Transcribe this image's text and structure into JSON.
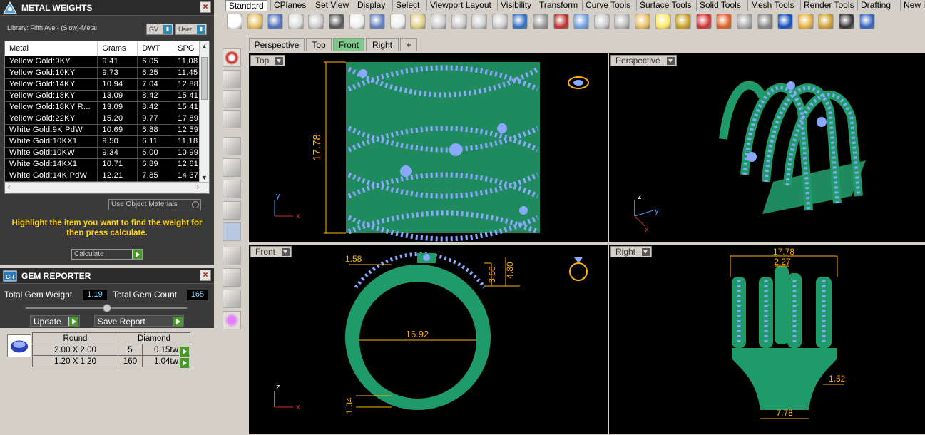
{
  "metal_panel": {
    "title": "METAL WEIGHTS",
    "library": "Library: Fifth Ave - (Slow)-Metal",
    "gv_label": "GV",
    "user_label": "User",
    "columns": [
      "Metal",
      "Grams",
      "DWT",
      "SPG"
    ],
    "rows": [
      [
        "Yellow Gold:9KY",
        "9.41",
        "6.05",
        "11.08"
      ],
      [
        "Yellow Gold:10KY",
        "9.73",
        "6.25",
        "11.45"
      ],
      [
        "Yellow Gold:14KY",
        "10.94",
        "7.04",
        "12.88"
      ],
      [
        "Yellow Gold:18KY",
        "13.09",
        "8.42",
        "15.41"
      ],
      [
        "Yellow Gold:18KY R...",
        "13.09",
        "8.42",
        "15.41"
      ],
      [
        "Yellow Gold:22KY",
        "15.20",
        "9.77",
        "17.89"
      ],
      [
        "White Gold:9K PdW",
        "10.69",
        "6.88",
        "12.59"
      ],
      [
        "White Gold:10KX1",
        "9.50",
        "6.11",
        "11.18"
      ],
      [
        "White Gold:10KW",
        "9.34",
        "6.00",
        "10.99"
      ],
      [
        "White Gold:14KX1",
        "10.71",
        "6.89",
        "12.61"
      ],
      [
        "White Gold:14K PdW",
        "12.21",
        "7.85",
        "14.37"
      ]
    ],
    "use_object_materials": "Use Object Materials",
    "hint": "Highlight the item you want to find the weight for then press calculate.",
    "calculate_label": "Calculate"
  },
  "gem_panel": {
    "title": "GEM REPORTER",
    "total_weight_label": "Total Gem Weight",
    "total_weight": "1.19",
    "total_count_label": "Total Gem Count",
    "total_count": "165",
    "update_label": "Update",
    "save_label": "Save Report",
    "shape": "Round",
    "stone": "Diamond",
    "rows": [
      {
        "size": "2.00 X 2.00",
        "count": "5",
        "tw": "0.15tw"
      },
      {
        "size": "1.20 X 1.20",
        "count": "160",
        "tw": "1.04tw"
      }
    ]
  },
  "menu_tabs": [
    "Standard",
    "CPlanes",
    "Set View",
    "Display",
    "Select",
    "Viewport Layout",
    "Visibility",
    "Transform",
    "Curve Tools",
    "Surface Tools",
    "Solid Tools",
    "Mesh Tools",
    "Render Tools",
    "Drafting",
    "New in"
  ],
  "view_tabs": [
    "Perspective",
    "Top",
    "Front",
    "Right",
    "+"
  ],
  "viewports": {
    "top": {
      "label": "Top",
      "dim_height": "17.78"
    },
    "perspective": {
      "label": "Perspective"
    },
    "front": {
      "label": "Front",
      "dim_a": "1.58",
      "dim_b": "3.66",
      "dim_c": "4.80",
      "dim_d": "16.92",
      "dim_e": "1.34"
    },
    "right": {
      "label": "Right",
      "dim_a": "17.78",
      "dim_b": "2.27",
      "dim_c": "1.52",
      "dim_d": "7.78"
    }
  },
  "colors": {
    "model_green": "#1f9b6a",
    "gem_blue": "#8aa8ff",
    "dimension": "#ffb000"
  }
}
